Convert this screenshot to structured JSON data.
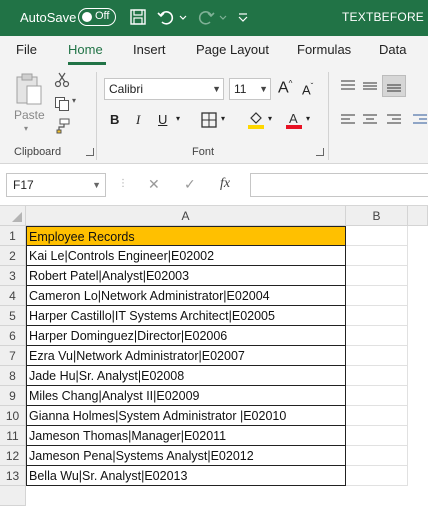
{
  "titlebar": {
    "autosave_label": "AutoSave",
    "toggle_state": "Off",
    "document_name": "TEXTBEFORE"
  },
  "tabs": [
    "File",
    "Home",
    "Insert",
    "Page Layout",
    "Formulas",
    "Data"
  ],
  "active_tab": "Home",
  "clipboard": {
    "paste_label": "Paste",
    "group_label": "Clipboard"
  },
  "font": {
    "name": "Calibri",
    "size": "11",
    "group_label": "Font",
    "bold": "B",
    "italic": "I",
    "underline": "U",
    "grow": "A",
    "shrink": "A",
    "font_color_accent": "#e81123",
    "fill_color_accent": "#ffd700"
  },
  "formula_bar": {
    "name_box": "F17",
    "fx": "fx",
    "cancel": "✕",
    "enter": "✓",
    "value": ""
  },
  "sheet": {
    "columns": [
      "A",
      "B"
    ],
    "rows": [
      {
        "num": "1",
        "a": "Employee Records"
      },
      {
        "num": "2",
        "a": "Kai Le|Controls Engineer|E02002"
      },
      {
        "num": "3",
        "a": "Robert Patel|Analyst|E02003"
      },
      {
        "num": "4",
        "a": "Cameron Lo|Network Administrator|E02004"
      },
      {
        "num": "5",
        "a": "Harper Castillo|IT Systems Architect|E02005"
      },
      {
        "num": "6",
        "a": "Harper Dominguez|Director|E02006"
      },
      {
        "num": "7",
        "a": "Ezra Vu|Network Administrator|E02007"
      },
      {
        "num": "8",
        "a": "Jade Hu|Sr. Analyst|E02008"
      },
      {
        "num": "9",
        "a": "Miles Chang|Analyst II|E02009"
      },
      {
        "num": "10",
        "a": "Gianna Holmes|System Administrator |E02010"
      },
      {
        "num": "11",
        "a": "Jameson Thomas|Manager|E02011"
      },
      {
        "num": "12",
        "a": "Jameson Pena|Systems Analyst|E02012"
      },
      {
        "num": "13",
        "a": "Bella Wu|Sr. Analyst|E02013"
      }
    ],
    "header_fill": "#ffc000"
  }
}
